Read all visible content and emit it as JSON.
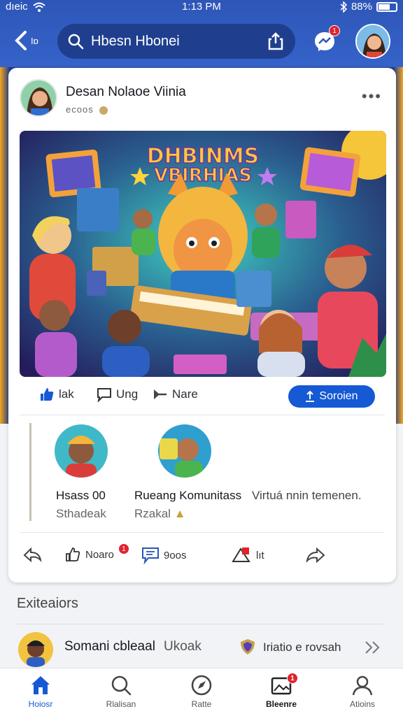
{
  "status_bar": {
    "carrier": "dıeic",
    "time": "1:13 PM",
    "battery": "88%"
  },
  "header": {
    "back_label": "Iɒ",
    "search_value": "Hbesn Hbonei",
    "notif_badge": "1"
  },
  "post": {
    "author": "Desan Nolaoe Viinia",
    "meta": "ecoos",
    "more": "•••",
    "image_title_line1": "DHBINMS",
    "image_title_line2": "VBIRHIAS",
    "actions": {
      "like": "lak",
      "comment": "Ung",
      "share": "Nare",
      "cta": "Soroien"
    }
  },
  "community": {
    "items": [
      {
        "name": "Hsass 00",
        "sub": "Sthadeak"
      },
      {
        "name": "Rueang Komunitass",
        "sub": "Rzakal"
      }
    ],
    "extra": "Virtuá nnin temenen."
  },
  "reactions": {
    "like_label": "Noaro",
    "like_badge": "1",
    "comment_label": "9oos",
    "bookmark_label": "lıt"
  },
  "section": {
    "title": "Exiteaiors",
    "suggest_name": "Somani cbleaal",
    "suggest_extra": "Ukoak",
    "suggest_action": "Iriatio e rovsah"
  },
  "bottom_nav": {
    "items": [
      {
        "label": "Hoiosr"
      },
      {
        "label": "Rlalisan"
      },
      {
        "label": "Ratte"
      },
      {
        "label": "Bleenre",
        "badge": "1"
      },
      {
        "label": "Atioins"
      }
    ]
  },
  "colors": {
    "brand_blue": "#2e56b8",
    "accent_blue": "#1659d4",
    "badge_red": "#e0232e"
  }
}
